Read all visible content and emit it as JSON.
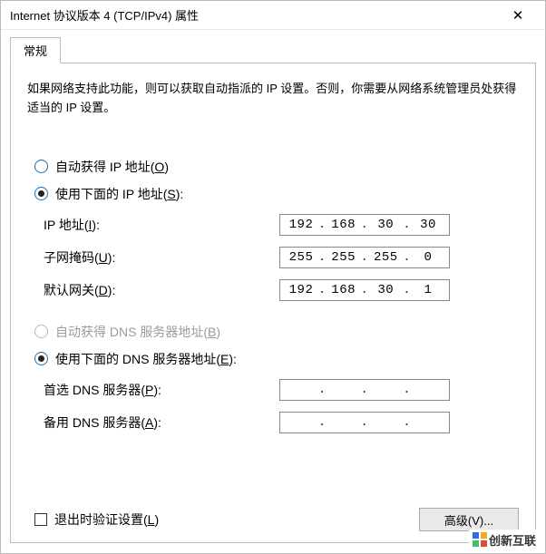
{
  "window": {
    "title": "Internet 协议版本 4 (TCP/IPv4) 属性",
    "close_glyph": "✕"
  },
  "tab": {
    "label": "常规"
  },
  "description": "如果网络支持此功能，则可以获取自动指派的 IP 设置。否则，你需要从网络系统管理员处获得适当的 IP 设置。",
  "ip_section": {
    "auto": {
      "label_pre": "自动获得 IP 地址(",
      "hotkey": "O",
      "label_post": ")",
      "checked": false
    },
    "manual": {
      "label_pre": "使用下面的 IP 地址(",
      "hotkey": "S",
      "label_post": "):",
      "checked": true
    },
    "fields": {
      "ip": {
        "label_pre": "IP 地址(",
        "hotkey": "I",
        "label_post": "):",
        "o1": "192",
        "o2": "168",
        "o3": "30",
        "o4": "30"
      },
      "mask": {
        "label_pre": "子网掩码(",
        "hotkey": "U",
        "label_post": "):",
        "o1": "255",
        "o2": "255",
        "o3": "255",
        "o4": "0"
      },
      "gateway": {
        "label_pre": "默认网关(",
        "hotkey": "D",
        "label_post": "):",
        "o1": "192",
        "o2": "168",
        "o3": "30",
        "o4": "1"
      }
    }
  },
  "dns_section": {
    "auto": {
      "label_pre": "自动获得 DNS 服务器地址(",
      "hotkey": "B",
      "label_post": ")",
      "checked": false,
      "disabled": true
    },
    "manual": {
      "label_pre": "使用下面的 DNS 服务器地址(",
      "hotkey": "E",
      "label_post": "):",
      "checked": true
    },
    "fields": {
      "primary": {
        "label_pre": "首选 DNS 服务器(",
        "hotkey": "P",
        "label_post": "):",
        "o1": "",
        "o2": "",
        "o3": "",
        "o4": ""
      },
      "alternate": {
        "label_pre": "备用 DNS 服务器(",
        "hotkey": "A",
        "label_post": "):",
        "o1": "",
        "o2": "",
        "o3": "",
        "o4": ""
      }
    }
  },
  "validate": {
    "label_pre": "退出时验证设置(",
    "hotkey": "L",
    "label_post": ")",
    "checked": false
  },
  "advanced_button": {
    "label": "高级(V)..."
  },
  "watermark": {
    "text": "创新互联"
  }
}
